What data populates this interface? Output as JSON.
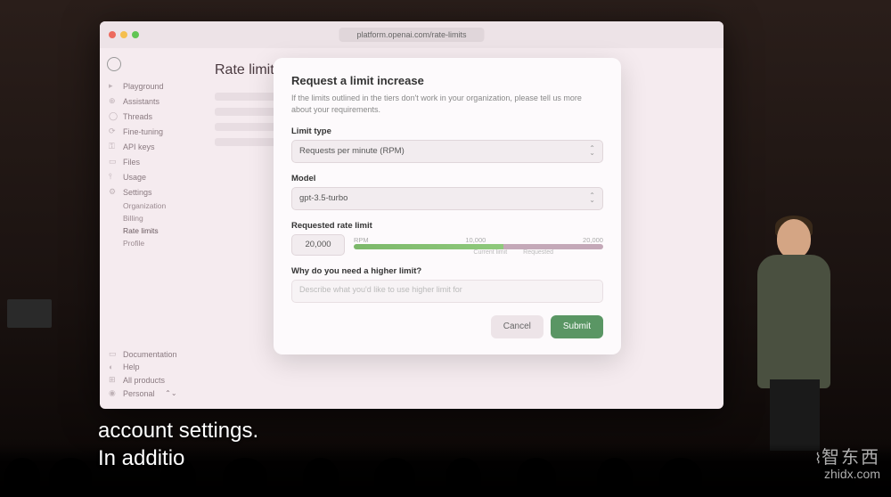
{
  "browser": {
    "url": "platform.openai.com/rate-limits"
  },
  "page": {
    "title": "Rate limits"
  },
  "sidebar": {
    "items": [
      {
        "icon": "▸",
        "label": "Playground"
      },
      {
        "icon": "⊕",
        "label": "Assistants"
      },
      {
        "icon": "◯",
        "label": "Threads"
      },
      {
        "icon": "⟳",
        "label": "Fine-tuning"
      },
      {
        "icon": "⚿",
        "label": "API keys"
      },
      {
        "icon": "▭",
        "label": "Files"
      },
      {
        "icon": "⫯",
        "label": "Usage"
      },
      {
        "icon": "⚙",
        "label": "Settings"
      }
    ],
    "subitems": [
      "Organization",
      "Billing",
      "Rate limits",
      "Profile"
    ],
    "bottom": [
      {
        "icon": "▭",
        "label": "Documentation"
      },
      {
        "icon": "◐",
        "label": "Help"
      },
      {
        "icon": "⊞",
        "label": "All products"
      },
      {
        "icon": "◉",
        "label": "Personal"
      }
    ]
  },
  "modal": {
    "title": "Request a limit increase",
    "desc": "If the limits outlined in the tiers don't work in your organization, please tell us more about your requirements.",
    "limit_type": {
      "label": "Limit type",
      "value": "Requests per minute (RPM)"
    },
    "model": {
      "label": "Model",
      "value": "gpt-3.5-turbo"
    },
    "requested": {
      "label": "Requested rate limit",
      "value": "20,000",
      "min": "RPM",
      "mid": "10,000",
      "max": "20,000",
      "current_label": "Current limit",
      "requested_label": "Requested"
    },
    "why": {
      "label": "Why do you need a higher limit?",
      "placeholder": "Describe what you'd like to use higher limit for"
    },
    "cancel": "Cancel",
    "submit": "Submit"
  },
  "subtitle": {
    "line1": "account settings.",
    "line2": "In additio"
  },
  "watermark": {
    "cn": "智东西",
    "en": "zhidx.com"
  }
}
